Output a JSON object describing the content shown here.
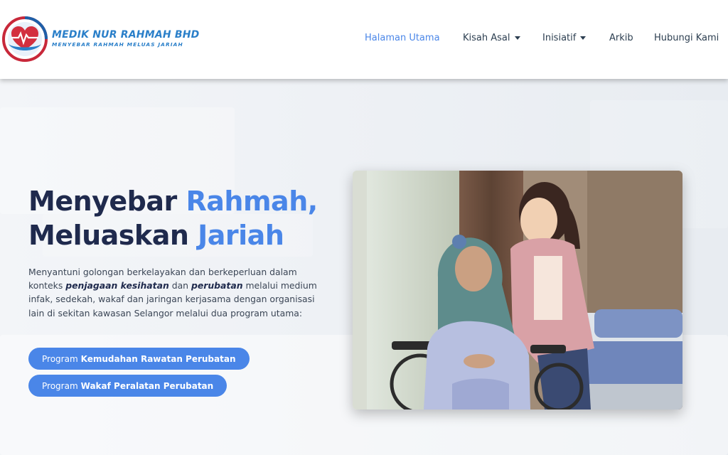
{
  "header": {
    "brand_name": "MEDIK NUR RAHMAH BHD",
    "brand_tagline": "MENYEBAR RAHMAH MELUAS JARIAH",
    "logo_icon": "heart-hands-logo",
    "brand_color": "#2a7fc9"
  },
  "nav": {
    "items": [
      {
        "label": "Halaman Utama",
        "active": true
      },
      {
        "label": "Kisah Asal",
        "dropdown": true
      },
      {
        "label": "Inisiatif",
        "dropdown": true
      },
      {
        "label": "Arkib"
      },
      {
        "label": "Hubungi Kami"
      }
    ]
  },
  "hero": {
    "headline_1a": "Menyebar ",
    "headline_1b": "Rahmah,",
    "headline_2a": "Meluaskan ",
    "headline_2b": "Jariah",
    "desc_1": "Menyantuni golongan berkelayakan dan berkeperluan dalam konteks ",
    "desc_bold_1": "penjagaan kesihatan",
    "desc_2": " dan ",
    "desc_bold_2": "perubatan",
    "desc_3": " melalui medium infak, sedekah, wakaf dan jaringan kerjasama dengan organisasi lain di sekitan kawasan Selangor melalui dua program utama:",
    "buttons": [
      {
        "prefix": "Program",
        "bold": "Kemudahan Rawatan Perubatan"
      },
      {
        "prefix": "Program",
        "bold": "Wakaf Peralatan Perubatan"
      }
    ],
    "accent_color": "#4a86e8",
    "heading_color": "#1f2a4d"
  }
}
